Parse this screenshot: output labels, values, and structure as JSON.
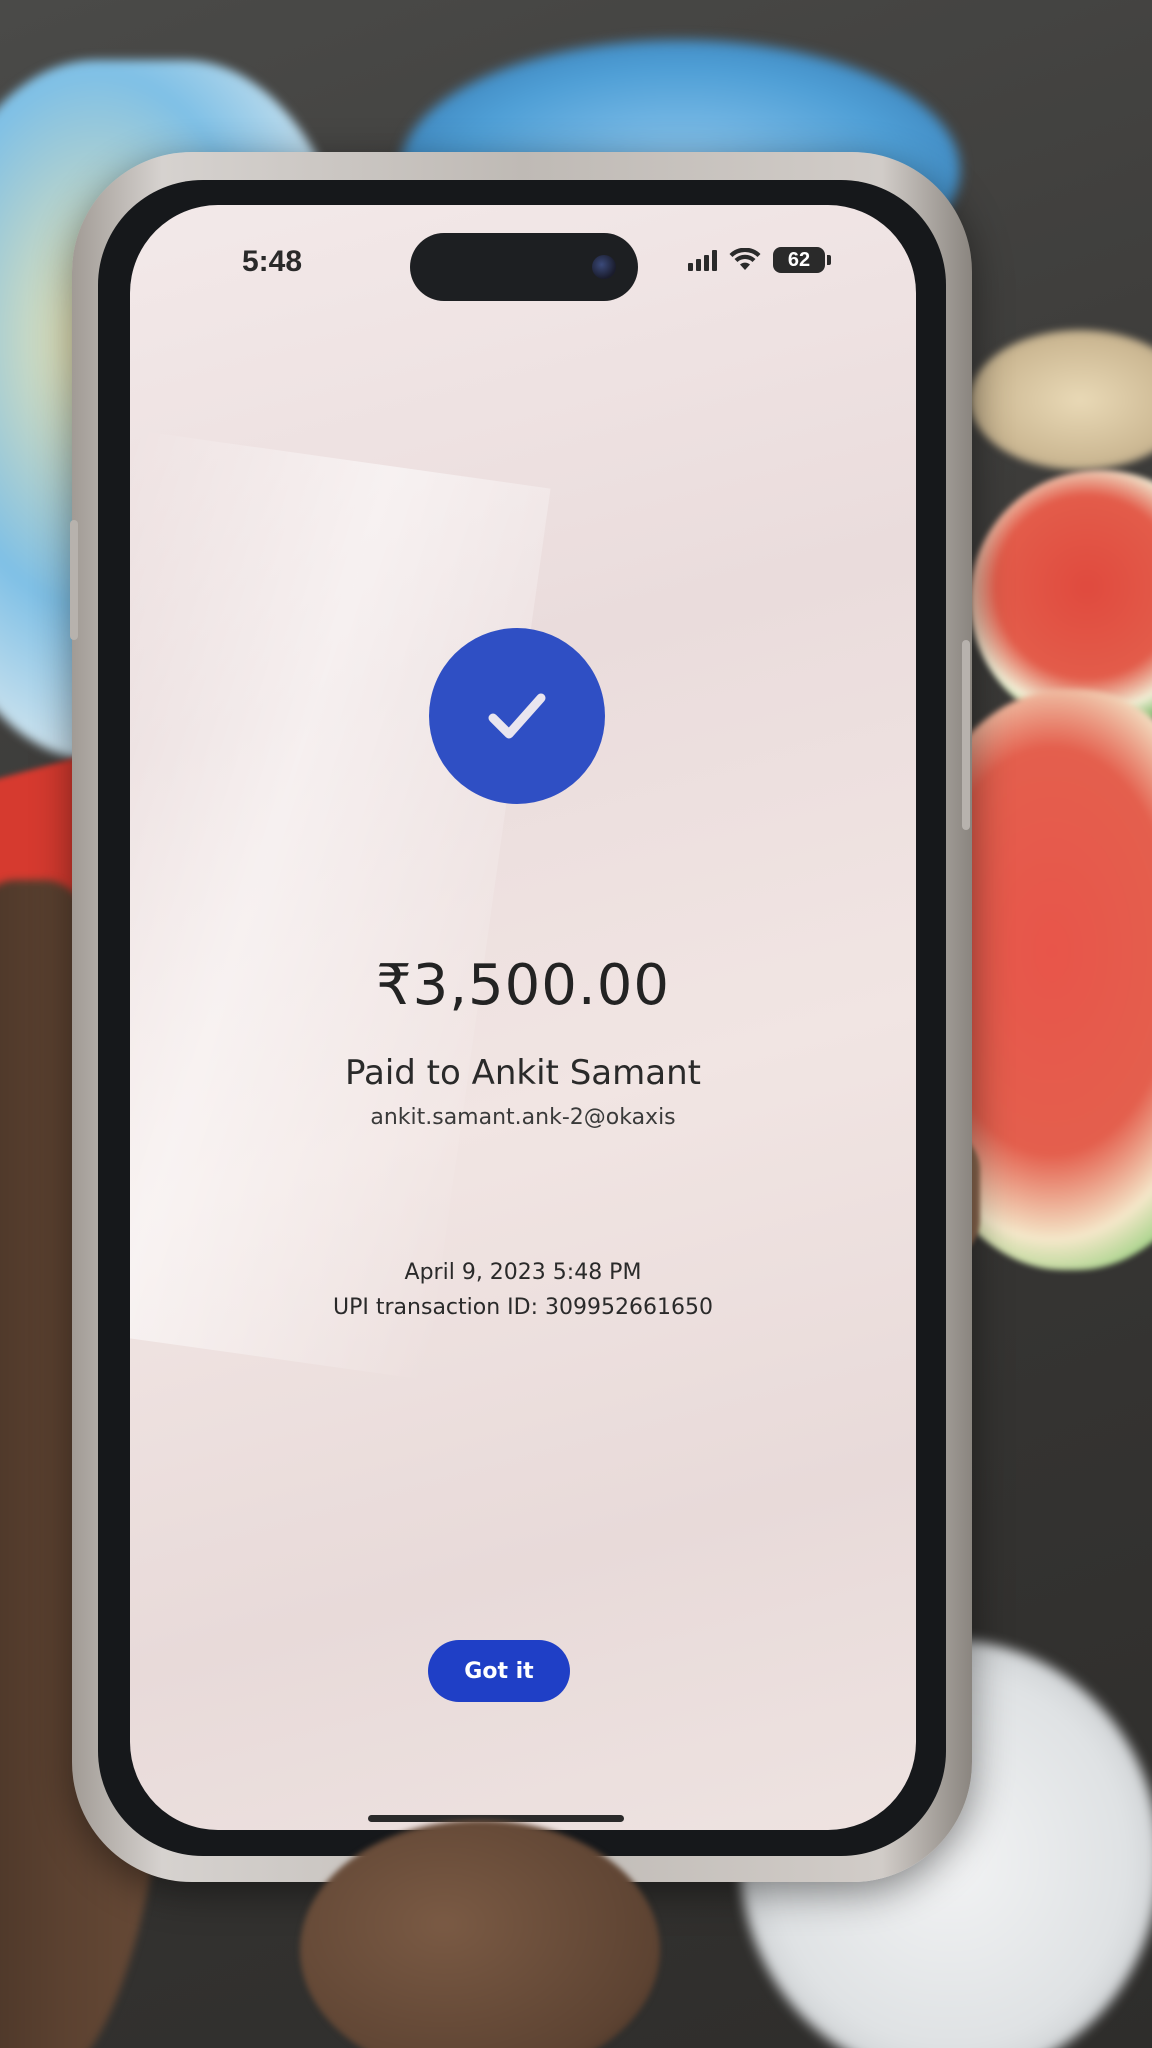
{
  "status_bar": {
    "time": "5:48",
    "battery": "62",
    "icons": [
      "signal-icon",
      "wifi-icon",
      "battery-icon"
    ]
  },
  "payment": {
    "amount": "₹3,500.00",
    "paid_to": "Paid to Ankit Samant",
    "upi_id": "ankit.samant.ank-2@okaxis",
    "datetime": "April 9, 2023 5:48 PM",
    "transaction_id": "UPI transaction ID: 309952661650",
    "success_icon": "check-icon"
  },
  "actions": {
    "got_it_label": "Got it"
  },
  "colors": {
    "accent": "#2f4fc4",
    "button": "#1f3fc6",
    "screen_background": "#efe3e2",
    "text": "#232323"
  }
}
